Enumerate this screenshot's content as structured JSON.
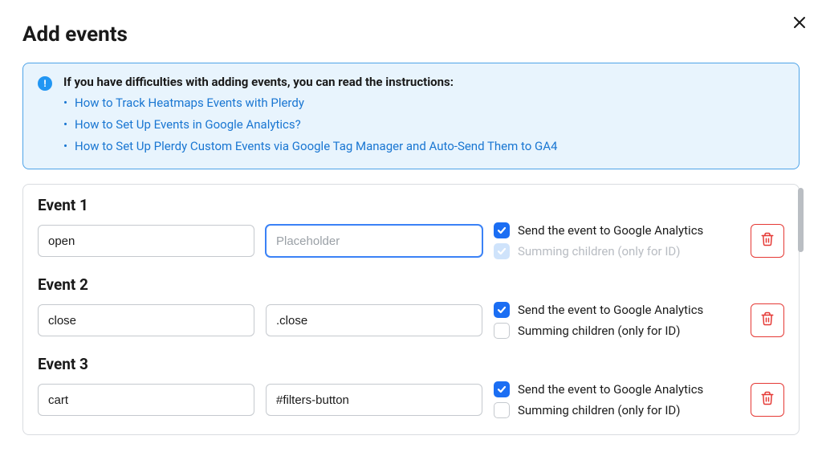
{
  "modal": {
    "title": "Add events"
  },
  "info": {
    "title": "If you have difficulties with adding events, you can read the instructions:",
    "links": [
      "How to Track Heatmaps Events with Plerdy",
      "How to Set Up Events in Google Analytics?",
      "How to Set Up Plerdy Custom Events via Google Tag Manager and Auto-Send Them to GA4"
    ]
  },
  "labels": {
    "send_ga": "Send the event to Google Analytics",
    "summing": "Summing children (only for ID)",
    "placeholder": "Placeholder"
  },
  "events": [
    {
      "title": "Event 1",
      "name": "open",
      "selector": "",
      "selector_focused": true,
      "ga_checked": true,
      "sum_checked": true,
      "sum_disabled": true
    },
    {
      "title": "Event 2",
      "name": "close",
      "selector": ".close",
      "selector_focused": false,
      "ga_checked": true,
      "sum_checked": false,
      "sum_disabled": false
    },
    {
      "title": "Event 3",
      "name": "cart",
      "selector": "#filters-button",
      "selector_focused": false,
      "ga_checked": true,
      "sum_checked": false,
      "sum_disabled": false
    }
  ]
}
